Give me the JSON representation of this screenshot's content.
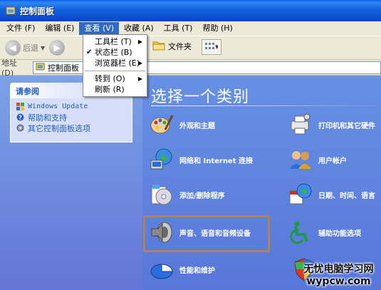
{
  "window": {
    "title": "控制面板"
  },
  "menubar": {
    "items": [
      "文件 (F)",
      "编辑 (E)",
      "查看 (V)",
      "收藏 (A)",
      "工具 (T)",
      "帮助 (H)"
    ],
    "active": "查看 (V)"
  },
  "view_menu": {
    "items": [
      {
        "label": "工具栏 (T)",
        "checked": false,
        "submenu": true
      },
      {
        "label": "状态栏 (B)",
        "checked": true,
        "submenu": false
      },
      {
        "label": "浏览器栏 (E)",
        "checked": false,
        "submenu": true
      },
      {
        "label": "转到 (O)",
        "checked": false,
        "submenu": true
      },
      {
        "label": "刷新 (R)",
        "checked": false,
        "submenu": false
      }
    ]
  },
  "toolbar": {
    "back_label": "后退",
    "folders_label": "文件夹"
  },
  "address": {
    "label": "地址 (D)",
    "value": "控制面板"
  },
  "see_also": {
    "title": "请参阅",
    "links": [
      "Windows Update",
      "帮助和支持",
      "其它控制面板选项"
    ]
  },
  "main": {
    "heading": "选择一个类别",
    "categories": [
      {
        "label": "外观和主题",
        "icon": "appearance-themes-icon"
      },
      {
        "label": "打印机和其它硬件",
        "icon": "printer-hardware-icon"
      },
      {
        "label": "网络和 Internet 连接",
        "icon": "network-internet-icon"
      },
      {
        "label": "用户帐户",
        "icon": "user-accounts-icon"
      },
      {
        "label": "添加/删除程序",
        "icon": "add-remove-programs-icon"
      },
      {
        "label": "日期、时间、语言",
        "icon": "date-time-language-icon"
      },
      {
        "label": "声音、语音和音频设备",
        "icon": "sounds-audio-icon"
      },
      {
        "label": "辅助功能选项",
        "icon": "accessibility-icon"
      },
      {
        "label": "性能和维护",
        "icon": "performance-maintenance-icon"
      }
    ]
  },
  "watermark": {
    "line1": "无忧电脑学习网",
    "line2": "wypcw.com"
  },
  "colors": {
    "highlight_box": "#a98460",
    "titlebar": "#0b4fcf",
    "content_bg": "#5f83e0"
  }
}
